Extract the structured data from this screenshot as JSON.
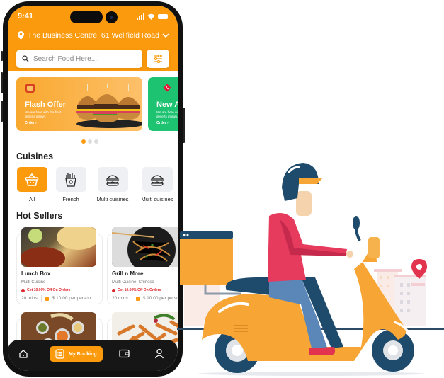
{
  "status_bar": {
    "time": "9:41"
  },
  "header": {
    "location": "The Business Centre, 61 Wellfield Road...",
    "search_placeholder": "Search Food Here....",
    "colors": {
      "accent": "#fb9a0c",
      "green": "#1ec371",
      "offer_red": "#e0272d"
    }
  },
  "banners": [
    {
      "brand": "burger-king-logo",
      "title": "Flash Offer",
      "subtitle": "We are here with the best deserts intown.",
      "link": "Order"
    },
    {
      "brand": "dominos-logo",
      "title": "New A",
      "subtitle": "We are here with the best deserts intown.",
      "link": "Order"
    }
  ],
  "carousel": {
    "pages": 3,
    "active": 1
  },
  "cuisines": {
    "title": "Cuisines",
    "items": [
      {
        "label": "All",
        "icon": "basket-icon",
        "active": true
      },
      {
        "label": "French",
        "icon": "fries-icon",
        "active": false
      },
      {
        "label": "Multi cuisines",
        "icon": "burger-icon",
        "active": false
      },
      {
        "label": "Multi cuisines",
        "icon": "burger-icon",
        "active": false
      }
    ]
  },
  "hot_sellers": {
    "title": "Hot Sellers",
    "items": [
      {
        "name": "Lunch Box",
        "category": "Multi Cuisine",
        "offer": "Get 10.00% Off On Orders",
        "time": "20 mins",
        "price": "$ 10.00 per person"
      },
      {
        "name": "Grill n More",
        "category": "Multi Cuisine, Chinese",
        "offer": "Get 10.00% Off On Orders",
        "time": "20 mins",
        "price": "$ 10.00 per person"
      }
    ]
  },
  "tabbar": {
    "items": [
      {
        "icon": "home-icon",
        "label": ""
      },
      {
        "icon": "booking-list-icon",
        "label": "My Booking",
        "active": true
      },
      {
        "icon": "wallet-icon",
        "label": ""
      },
      {
        "icon": "profile-icon",
        "label": ""
      }
    ]
  }
}
